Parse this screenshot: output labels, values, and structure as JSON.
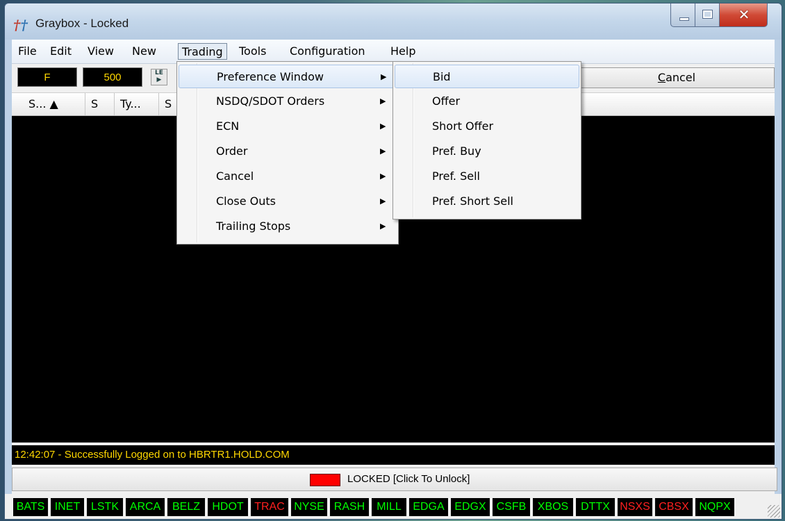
{
  "window": {
    "title": "Graybox - Locked"
  },
  "menubar": {
    "items": [
      "File",
      "Edit",
      "View",
      "New",
      "Trading",
      "Tools",
      "Configuration",
      "Help"
    ]
  },
  "toolbar": {
    "symbol": "F",
    "quantity": "500",
    "le_icon": "LE-icon",
    "cancel_label_accel": "C",
    "cancel_label_rest": "ancel"
  },
  "grid": {
    "columns": [
      "S... ▲",
      "S",
      "Ty...",
      "S"
    ]
  },
  "trading_menu": {
    "items": [
      "Preference Window",
      "NSDQ/SDOT Orders",
      "ECN",
      "Order",
      "Cancel",
      "Close Outs",
      "Trailing Stops"
    ]
  },
  "preference_submenu": {
    "items": [
      "Bid",
      "Offer",
      "Short Offer",
      "Pref. Buy",
      "Pref. Sell",
      "Pref. Short Sell"
    ]
  },
  "log": {
    "message": "12:42:07 - Successfully Logged on to HBRTR1.HOLD.COM"
  },
  "lock_bar": {
    "label": "LOCKED [Click To Unlock]",
    "indicator_color": "#ff0000"
  },
  "exchanges": [
    {
      "name": "BATS",
      "color": "#00ff00"
    },
    {
      "name": "INET",
      "color": "#00ff00"
    },
    {
      "name": "LSTK",
      "color": "#00ff00"
    },
    {
      "name": "ARCA",
      "color": "#00ff00"
    },
    {
      "name": "BELZ",
      "color": "#00ff00"
    },
    {
      "name": "HDOT",
      "color": "#00ff00"
    },
    {
      "name": "TRAC",
      "color": "#ff2020"
    },
    {
      "name": "NYSE",
      "color": "#00ff00"
    },
    {
      "name": "RASH",
      "color": "#00ff00"
    },
    {
      "name": "MILL",
      "color": "#00ff00"
    },
    {
      "name": "EDGA",
      "color": "#00ff00"
    },
    {
      "name": "EDGX",
      "color": "#00ff00"
    },
    {
      "name": "CSFB",
      "color": "#00ff00"
    },
    {
      "name": "XBOS",
      "color": "#00ff00"
    },
    {
      "name": "DTTX",
      "color": "#00ff00"
    },
    {
      "name": "NSXS",
      "color": "#ff2020"
    },
    {
      "name": "CBSX",
      "color": "#ff2020"
    },
    {
      "name": "NQPX",
      "color": "#00ff00"
    }
  ]
}
